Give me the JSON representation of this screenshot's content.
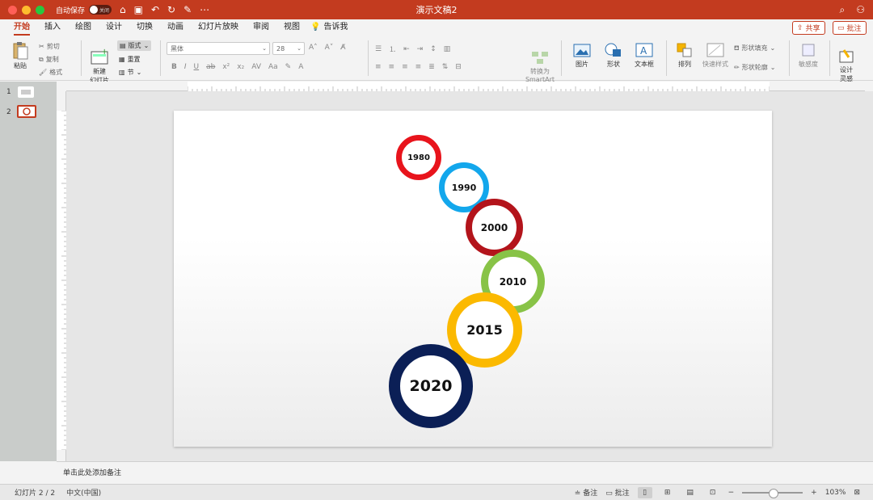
{
  "window": {
    "title": "演示文稿2",
    "autosave_label": "自动保存",
    "autosave_state": "关闭"
  },
  "tabs": [
    {
      "label": "开始"
    },
    {
      "label": "插入"
    },
    {
      "label": "绘图"
    },
    {
      "label": "设计"
    },
    {
      "label": "切换"
    },
    {
      "label": "动画"
    },
    {
      "label": "幻灯片放映"
    },
    {
      "label": "审阅"
    },
    {
      "label": "视图"
    }
  ],
  "tell_me": "告诉我",
  "share": "共享",
  "comments": "批注",
  "ribbon": {
    "paste": "粘贴",
    "cut": "剪切",
    "copy": "复制",
    "format": "格式",
    "new_slide": "新建\n幻灯片",
    "layout": "版式",
    "reset": "重置",
    "section": "节",
    "font_name": "黑体",
    "font_size": "28",
    "convert_smartart": "转换为\nSmartArt",
    "picture": "图片",
    "shape": "形状",
    "textbox": "文本框",
    "arrange": "排列",
    "quick_styles": "快速样式",
    "shape_fill": "形状填充",
    "shape_outline": "形状轮廓",
    "sensitivity": "敏感度",
    "designer": "设计\n灵感"
  },
  "slides": [
    {
      "number": "1"
    },
    {
      "number": "2"
    }
  ],
  "timeline": [
    {
      "year": "1980",
      "color": "#e8141c"
    },
    {
      "year": "1990",
      "color": "#13a7ec"
    },
    {
      "year": "2000",
      "color": "#b3141b"
    },
    {
      "year": "2010",
      "color": "#88c347"
    },
    {
      "year": "2015",
      "color": "#fbb900"
    },
    {
      "year": "2020",
      "color": "#0b1f56"
    }
  ],
  "notes_placeholder": "单击此处添加备注",
  "status": {
    "slide_info": "幻灯片 2 / 2",
    "language": "中文(中国)",
    "notes": "备注",
    "comments": "批注",
    "zoom": "103%"
  },
  "accent_color": "#c33b1f"
}
